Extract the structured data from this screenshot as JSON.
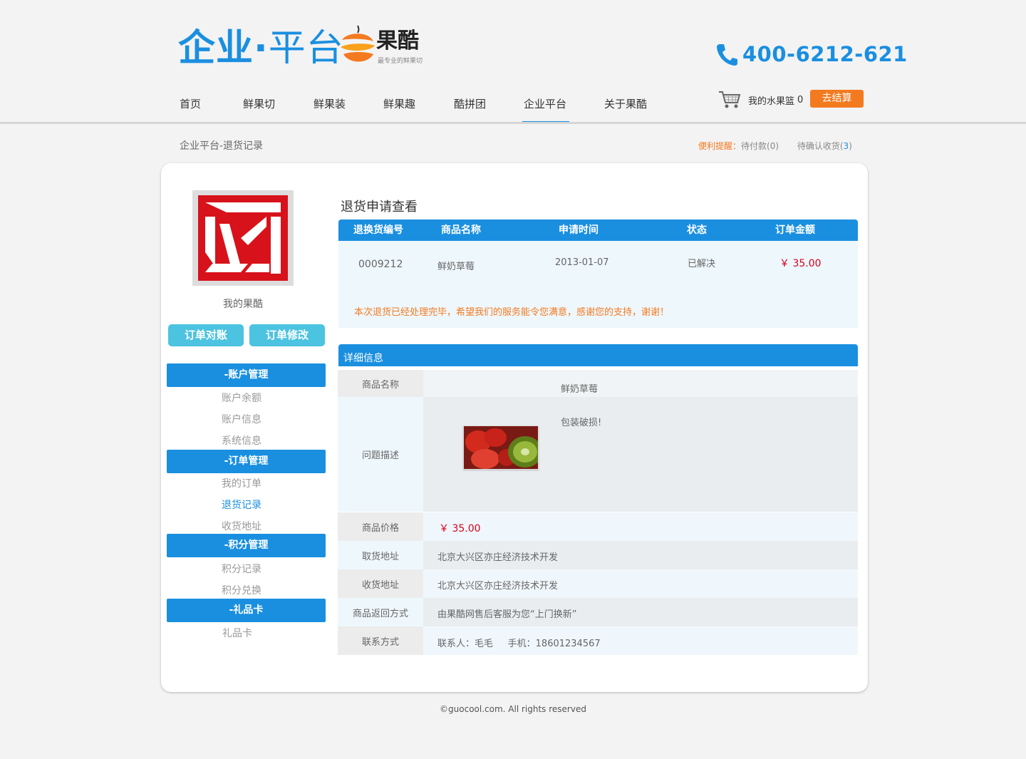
{
  "header": {
    "brand_left": "企业",
    "brand_dot": "·",
    "brand_right": "平台",
    "logo_name": "果酷",
    "logo_slogan": "最专业的鲜果切",
    "phone": "400-6212-621"
  },
  "nav": {
    "items": [
      {
        "label": "首页"
      },
      {
        "label": "鲜果切"
      },
      {
        "label": "鲜果装"
      },
      {
        "label": "鲜果趣"
      },
      {
        "label": "酷拼团"
      },
      {
        "label": "企业平台"
      },
      {
        "label": "关于果酷"
      }
    ],
    "active": "企业平台"
  },
  "cart": {
    "label": "我的水果篮",
    "count": "0",
    "checkout": "去结算"
  },
  "breadcrumb": "企业平台-退货记录",
  "reminder": {
    "label": "便利提醒",
    "colon": "：",
    "pending_payment": "待付款(0)",
    "pending_receipt_prefix": "待确认收货(",
    "pending_receipt_count": "3",
    "pending_receipt_suffix": ")"
  },
  "sidebar": {
    "profile_name": "我的果酷",
    "buttons": [
      "订单对账",
      "订单修改"
    ],
    "sections": [
      {
        "title": "-账户管理",
        "links": [
          "账户余额",
          "账户信息",
          "系统信息"
        ]
      },
      {
        "title": "-订单管理",
        "links": [
          "我的订单",
          "退货记录",
          "收货地址"
        ]
      },
      {
        "title": "-积分管理",
        "links": [
          "积分记录",
          "积分兑换"
        ]
      },
      {
        "title": "-礼品卡",
        "links": [
          "礼品卡"
        ]
      }
    ],
    "active_link": "退货记录"
  },
  "return_view": {
    "title": "退货申请查看",
    "columns": [
      "退换货编号",
      "商品名称",
      "申请时间",
      "状态",
      "订单金额"
    ],
    "row": {
      "id": "0009212",
      "product": "鲜奶草莓",
      "date": "2013-01-07",
      "status": "已解决",
      "amount": "￥ 35.00"
    },
    "notice": "本次退货已经处理完毕，希望我们的服务能令您满意，感谢您的支持，谢谢！"
  },
  "details": {
    "title": "详细信息",
    "product_name_label": "商品名称",
    "product_name": "鲜奶草莓",
    "issue_label": "问题描述",
    "issue_text": "包装破损!",
    "price_label": "商品价格",
    "price": "￥ 35.00",
    "pickup_label": "取货地址",
    "pickup": "北京大兴区亦庄经济技术开发",
    "delivery_label": "收货地址",
    "delivery": "北京大兴区亦庄经济技术开发",
    "return_method_label": "商品返回方式",
    "return_method": "由果酷网售后客服为您“上门换新”",
    "contact_label": "联系方式",
    "contact": "联系人：毛毛     手机：18601234567"
  },
  "footer": "©guocool.com. All rights reserved",
  "colors": {
    "brand_blue": "#1a8fe0",
    "accent_orange": "#f47a20",
    "price_red": "#d9001b",
    "button_teal": "#4cc3e0"
  }
}
